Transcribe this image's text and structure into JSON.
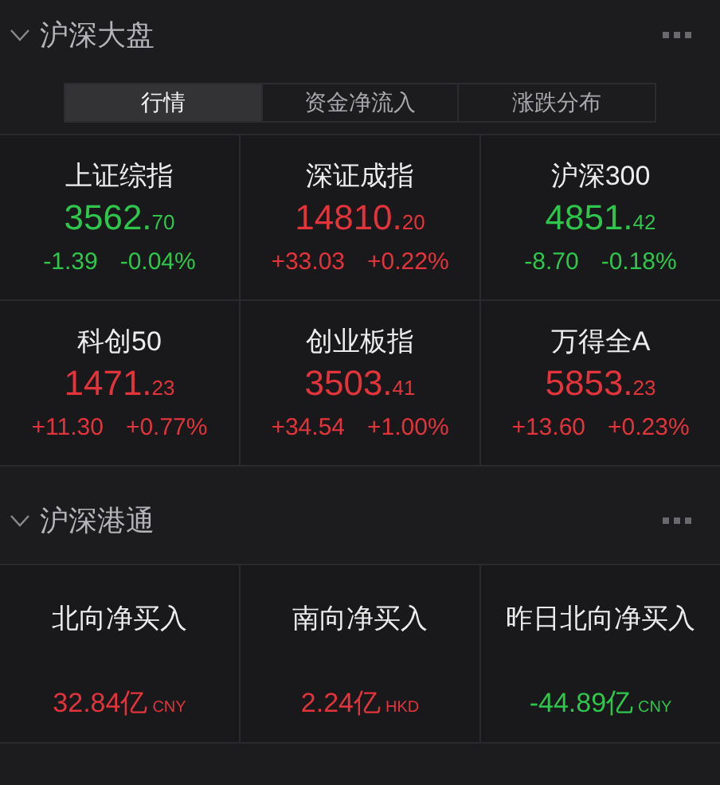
{
  "market_section": {
    "title": "沪深大盘",
    "expanded": true,
    "tabs": [
      {
        "label": "行情",
        "selected": true
      },
      {
        "label": "资金净流入",
        "selected": false
      },
      {
        "label": "涨跌分布",
        "selected": false
      }
    ],
    "indices": [
      {
        "name": "上证综指",
        "price": "3562.",
        "price_fraction": "70",
        "change": "-1.39",
        "change_pct": "-0.04%",
        "color": "#2ec64b"
      },
      {
        "name": "深证成指",
        "price": "14810.",
        "price_fraction": "20",
        "change": "+33.03",
        "change_pct": "+0.22%",
        "color": "#e3343c"
      },
      {
        "name": "沪深300",
        "price": "4851.",
        "price_fraction": "42",
        "change": "-8.70",
        "change_pct": "-0.18%",
        "color": "#2ec64b"
      },
      {
        "name": "科创50",
        "price": "1471.",
        "price_fraction": "23",
        "change": "+11.30",
        "change_pct": "+0.77%",
        "color": "#e3343c"
      },
      {
        "name": "创业板指",
        "price": "3503.",
        "price_fraction": "41",
        "change": "+34.54",
        "change_pct": "+1.00%",
        "color": "#e3343c"
      },
      {
        "name": "万得全A",
        "price": "5853.",
        "price_fraction": "23",
        "change": "+13.60",
        "change_pct": "+0.23%",
        "color": "#e3343c"
      }
    ]
  },
  "connect_section": {
    "title": "沪深港通",
    "expanded": true,
    "flows": [
      {
        "label": "北向净买入",
        "value": "32.84亿",
        "currency": "CNY",
        "color": "#e3343c"
      },
      {
        "label": "南向净买入",
        "value": "2.24亿",
        "currency": "HKD",
        "color": "#e3343c"
      },
      {
        "label": "昨日北向净买入",
        "value": "-44.89亿",
        "currency": "CNY",
        "color": "#2ec64b"
      }
    ]
  }
}
